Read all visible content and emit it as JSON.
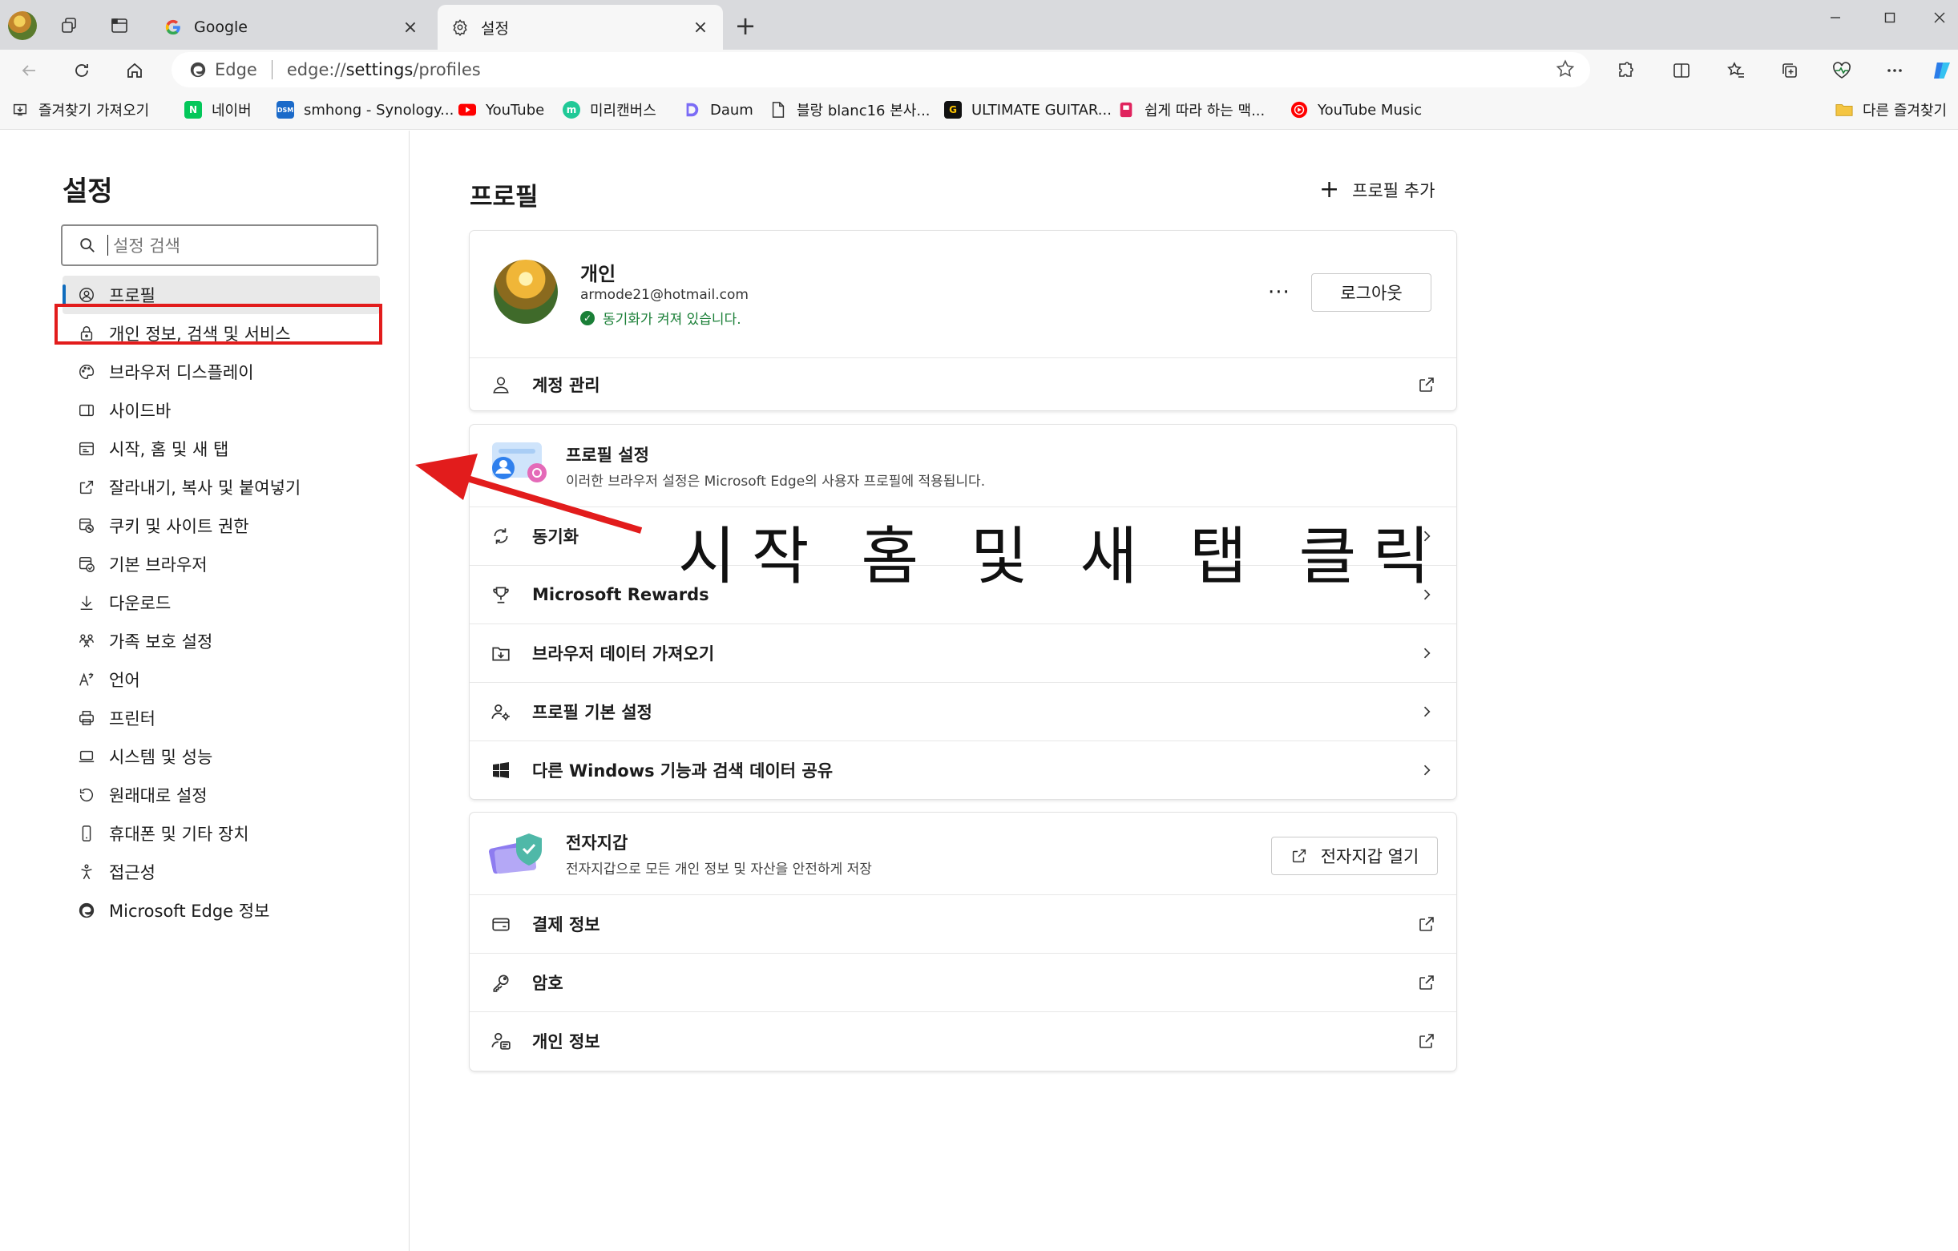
{
  "tabs": [
    {
      "title": "Google",
      "close": "×",
      "active": false
    },
    {
      "title": "설정",
      "close": "×",
      "active": true
    }
  ],
  "address_bar": {
    "edge_label": "Edge",
    "url_scheme": "edge://",
    "url_host": "settings",
    "url_path": "/profiles"
  },
  "favorites": [
    {
      "label": "즐겨찾기 가져오기",
      "icon": "import-favorites-icon"
    },
    {
      "label": "네이버",
      "icon": "naver-icon",
      "badge": "N",
      "color": "#03c75a"
    },
    {
      "label": "smhong - Synology...",
      "icon": "synology-dsm-icon",
      "badge": "DSM",
      "color": "#1b6ac9"
    },
    {
      "label": "YouTube",
      "icon": "youtube-icon",
      "color": "#ff0000"
    },
    {
      "label": "미리캔버스",
      "icon": "miricanvas-icon",
      "badge": "m",
      "color": "#20c997"
    },
    {
      "label": "Daum",
      "icon": "daum-icon",
      "color": "#6b6bff"
    },
    {
      "label": "블랑 blanc16 본사...",
      "icon": "page-icon"
    },
    {
      "label": "ULTIMATE GUITAR...",
      "icon": "ultimate-guitar-icon",
      "badge": "G",
      "color": "#111111"
    },
    {
      "label": "쉽게 따라 하는 맥...",
      "icon": "mac-guide-icon",
      "color": "#e0245e"
    },
    {
      "label": "YouTube Music",
      "icon": "youtube-music-icon",
      "color": "#ff0000"
    },
    {
      "label": "다른 즐겨찾기",
      "icon": "folder-icon"
    }
  ],
  "sidebar": {
    "title": "설정",
    "search_placeholder": "설정 검색",
    "items": [
      {
        "label": "프로필",
        "icon": "profile-icon",
        "selected": true
      },
      {
        "label": "개인 정보, 검색 및 서비스",
        "icon": "lock-icon"
      },
      {
        "label": "브라우저 디스플레이",
        "icon": "palette-icon"
      },
      {
        "label": "사이드바",
        "icon": "sidebar-icon"
      },
      {
        "label": "시작, 홈 및 새 탭",
        "icon": "home-tab-icon"
      },
      {
        "label": "잘라내기, 복사 및 붙여넣기",
        "icon": "share-icon"
      },
      {
        "label": "쿠키 및 사이트 권한",
        "icon": "cookie-permission-icon"
      },
      {
        "label": "기본 브라우저",
        "icon": "default-browser-icon"
      },
      {
        "label": "다운로드",
        "icon": "download-icon"
      },
      {
        "label": "가족 보호 설정",
        "icon": "family-icon"
      },
      {
        "label": "언어",
        "icon": "language-icon"
      },
      {
        "label": "프린터",
        "icon": "printer-icon"
      },
      {
        "label": "시스템 및 성능",
        "icon": "laptop-icon"
      },
      {
        "label": "원래대로 설정",
        "icon": "reset-icon"
      },
      {
        "label": "휴대폰 및 기타 장치",
        "icon": "phone-icon"
      },
      {
        "label": "접근성",
        "icon": "accessibility-icon"
      },
      {
        "label": "Microsoft Edge 정보",
        "icon": "edge-icon"
      }
    ]
  },
  "main": {
    "title": "프로필",
    "add_profile": "프로필 추가",
    "profile": {
      "name": "개인",
      "email": "armode21@hotmail.com",
      "sync_status": "동기화가 켜져 있습니다.",
      "more": "···",
      "signout": "로그아웃",
      "manage_account": "계정 관리"
    },
    "profile_settings": {
      "title": "프로필 설정",
      "subtitle": "이러한 브라우저 설정은 Microsoft Edge의 사용자 프로필에 적용됩니다.",
      "rows": [
        {
          "label": "동기화",
          "icon": "sync-icon"
        },
        {
          "label": "Microsoft Rewards",
          "icon": "trophy-icon"
        },
        {
          "label": "브라우저 데이터 가져오기",
          "icon": "import-data-icon"
        },
        {
          "label": "프로필 기본 설정",
          "icon": "profile-settings-icon"
        },
        {
          "label": "다른 Windows 기능과 검색 데이터 공유",
          "icon": "windows-icon"
        }
      ]
    },
    "wallet": {
      "title": "전자지갑",
      "subtitle": "전자지갑으로 모든 개인 정보 및 자산을 안전하게 저장",
      "open_button": "전자지갑 열기",
      "rows": [
        {
          "label": "결제 정보",
          "icon": "card-icon"
        },
        {
          "label": "암호",
          "icon": "key-icon"
        },
        {
          "label": "개인 정보",
          "icon": "personal-info-icon"
        }
      ]
    }
  },
  "annotation": {
    "text": "시작 홈 및 새 탭 클릭",
    "color": "#e21c1c"
  },
  "colors": {
    "accent": "#0f6cbd",
    "highlight": "#e21c1c",
    "sync_green": "#1a7f37"
  }
}
